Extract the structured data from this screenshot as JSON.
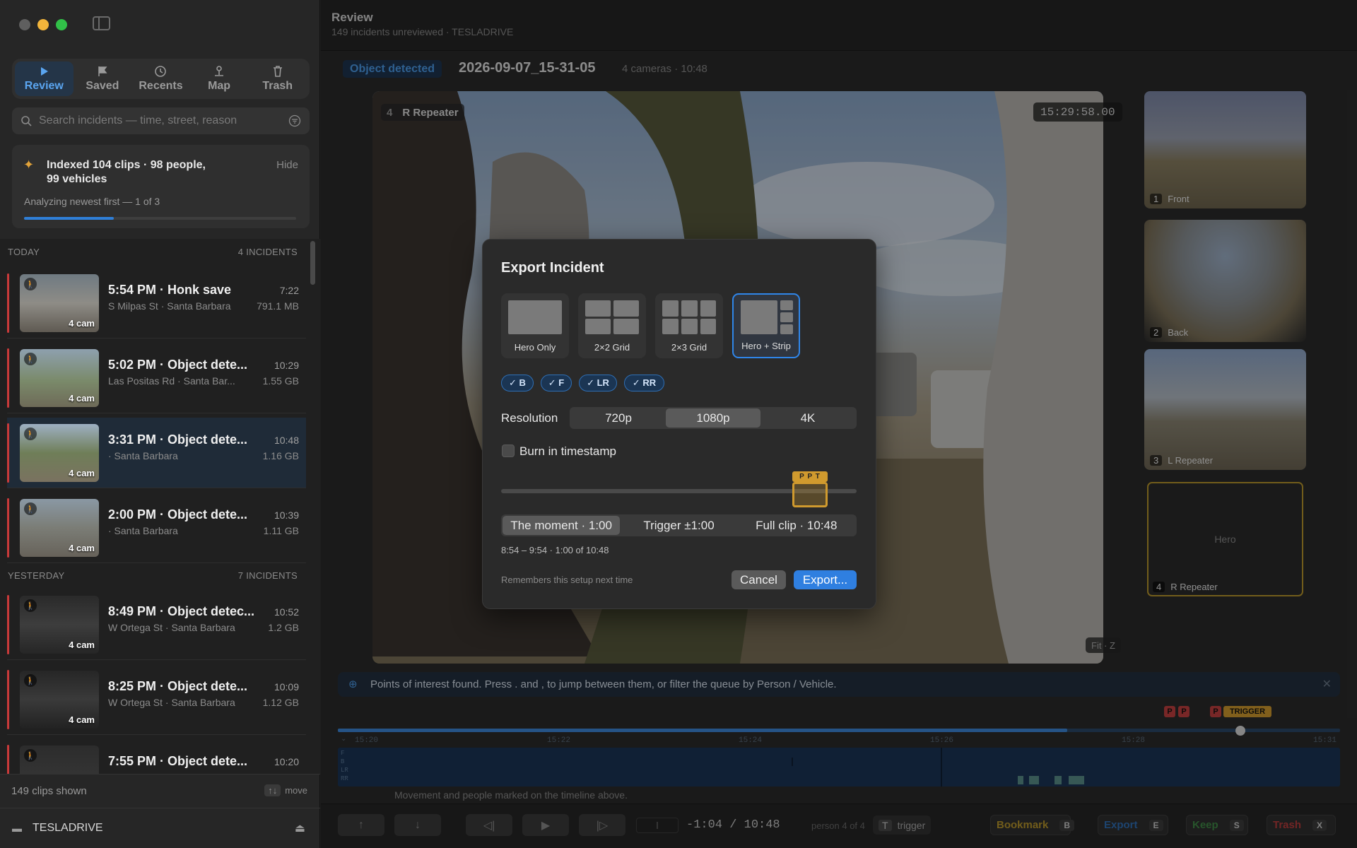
{
  "app": {
    "title": "Review",
    "subtitle": "149 incidents unreviewed · TESLADRIVE"
  },
  "nav": [
    {
      "label": "Review",
      "icon": "play-icon",
      "active": true
    },
    {
      "label": "Saved",
      "icon": "flag-icon"
    },
    {
      "label": "Recents",
      "icon": "clock-icon"
    },
    {
      "label": "Map",
      "icon": "pin-icon"
    },
    {
      "label": "Trash",
      "icon": "trash-icon"
    }
  ],
  "search": {
    "placeholder": "Search incidents — time, street, reason"
  },
  "index_card": {
    "line1": "Indexed 104 clips · 98 people,",
    "line2": "99 vehicles",
    "hide": "Hide",
    "status": "Analyzing newest first — 1 of 3",
    "progress": 0.33
  },
  "sections": {
    "today": {
      "label": "TODAY",
      "count": "4 INCIDENTS"
    },
    "yesterday": {
      "label": "YESTERDAY",
      "count": "7 INCIDENTS"
    }
  },
  "incidents": [
    {
      "title": "5:54 PM · Honk save",
      "location": "S Milpas St · Santa Barbara",
      "duration": "7:22",
      "size": "791.1 MB",
      "cams": "4 cam"
    },
    {
      "title": "5:02 PM · Object dete...",
      "location": "Las Positas Rd · Santa Bar...",
      "duration": "10:29",
      "size": "1.55 GB",
      "cams": "4 cam"
    },
    {
      "title": "3:31 PM · Object dete...",
      "location": " · Santa Barbara",
      "duration": "10:48",
      "size": "1.16 GB",
      "cams": "4 cam"
    },
    {
      "title": "2:00 PM · Object dete...",
      "location": " · Santa Barbara",
      "duration": "10:39",
      "size": "1.11 GB",
      "cams": "4 cam"
    },
    {
      "title": "8:49 PM · Object detec...",
      "location": "W Ortega St · Santa Barbara",
      "duration": "10:52",
      "size": "1.2 GB",
      "cams": "4 cam"
    },
    {
      "title": "8:25 PM · Object dete...",
      "location": "W Ortega St · Santa Barbara",
      "duration": "10:09",
      "size": "1.12 GB",
      "cams": "4 cam"
    },
    {
      "title": "7:55 PM · Object dete...",
      "location": "",
      "duration": "10:20",
      "size": "",
      "cams": ""
    }
  ],
  "footer": {
    "clips_shown": "149 clips shown",
    "move_hint": "move",
    "move_keys": "↑↓",
    "drive": "TESLADRIVE"
  },
  "incident_header": {
    "badge": "Object detected",
    "name": "2026-09-07_15-31-05",
    "meta": "4 cameras · 10:48"
  },
  "hero": {
    "num": "4",
    "label": "R Repeater",
    "timestamp": "15:29:58.00",
    "fit": "Fit · Z"
  },
  "strip": [
    {
      "num": "1",
      "label": "Front"
    },
    {
      "num": "2",
      "label": "Back"
    },
    {
      "num": "3",
      "label": "L Repeater"
    },
    {
      "num": "4",
      "label": "R Repeater",
      "center": "Hero"
    }
  ],
  "modal": {
    "title": "Export Incident",
    "layouts": [
      {
        "label": "Hero Only"
      },
      {
        "label": "2×2 Grid"
      },
      {
        "label": "2×3 Grid"
      },
      {
        "label": "Hero + Strip",
        "selected": true
      }
    ],
    "cams": [
      "✓ B",
      "✓ F",
      "✓ LR",
      "✓ RR"
    ],
    "resolution_label": "Resolution",
    "resolutions": [
      "720p",
      "1080p",
      "4K"
    ],
    "resolution_selected": "1080p",
    "burn_label": "Burn in timestamp",
    "burn_checked": false,
    "range_marker": "P P T",
    "range_modes": [
      "The moment · 1:00",
      "Trigger ±1:00",
      "Full clip · 10:48"
    ],
    "range_selected": "The moment · 1:00",
    "range_text": "8:54 – 9:54 · 1:00 of 10:48",
    "remember": "Remembers this setup next time",
    "cancel": "Cancel",
    "export": "Export..."
  },
  "poi": {
    "text": "Points of interest found. Press  .  and  ,  to jump between them, or filter the queue by Person / Vehicle."
  },
  "timeline": {
    "flags": [
      "P",
      "P",
      "P",
      "TRIGGER"
    ],
    "ticks": [
      "15:20",
      "15:22",
      "15:24",
      "15:26",
      "15:28",
      "15:31"
    ],
    "lanes": [
      "F",
      "B",
      "LR",
      "RR"
    ],
    "hint": "Movement and people marked on the timeline above."
  },
  "transport": {
    "position": "-1:04",
    "duration": "/ 10:48",
    "person": "person 4 of 4",
    "trigger_key": "T",
    "trigger_label": "trigger"
  },
  "actions": [
    {
      "label": "Bookmark",
      "key": "B",
      "color": "#b8962c"
    },
    {
      "label": "Export",
      "key": "E",
      "color": "#2f6fb5"
    },
    {
      "label": "Keep",
      "key": "S",
      "color": "#3f8a46"
    },
    {
      "label": "Trash",
      "key": "X",
      "color": "#b83c3c"
    }
  ]
}
